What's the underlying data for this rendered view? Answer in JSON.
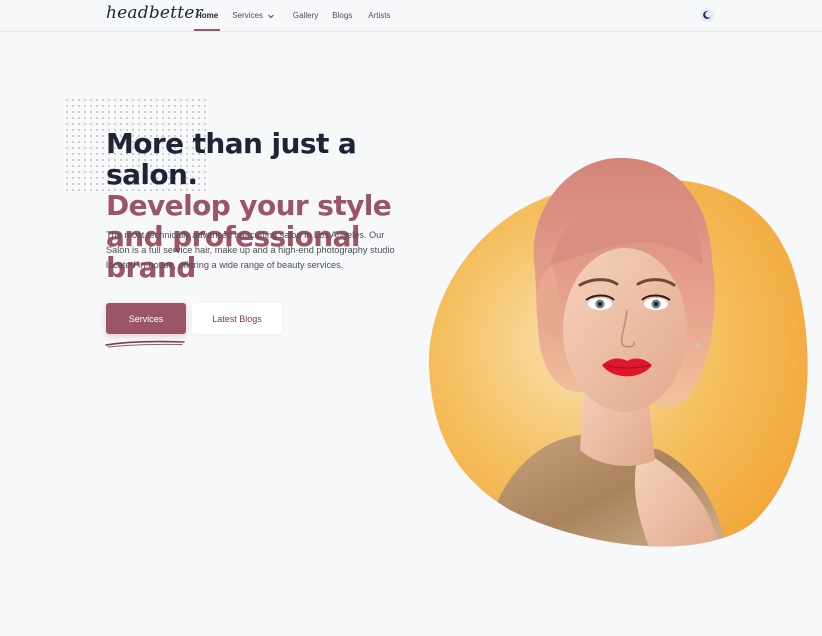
{
  "header": {
    "logo": "headbetter",
    "nav": [
      {
        "label": "Home",
        "active": true
      },
      {
        "label": "Services",
        "has_dropdown": true
      },
      {
        "label": "Gallery"
      },
      {
        "label": "Blogs"
      },
      {
        "label": "Artists"
      }
    ],
    "theme_toggle_icon": "moon-icon"
  },
  "hero": {
    "headline_line1": "More than just a salon.",
    "headline_line2": "Develop your style and professional brand",
    "description": "The most technically advanced haircutting salon in Los Angeles. Our Salon is a full service hair, make up and a high-end photography studio located in-house, offering a wide range of beauty services.",
    "primary_button": "Services",
    "secondary_button": "Latest Blogs"
  },
  "colors": {
    "brand": "#9c5566",
    "dark": "#1e2433",
    "blob": "#f3b24a",
    "background": "#f7f8fa"
  }
}
